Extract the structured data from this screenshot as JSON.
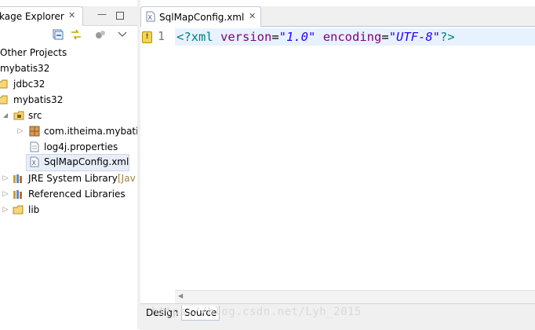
{
  "package_explorer": {
    "tab_label": "kage Explorer",
    "tree": [
      {
        "label": "Other Projects",
        "suffix": ""
      },
      {
        "label": "mybatis32",
        "suffix": ""
      },
      {
        "label": "jdbc32",
        "suffix": ""
      },
      {
        "label": "mybatis32",
        "suffix": ""
      },
      {
        "label": "src",
        "suffix": ""
      },
      {
        "label": "com.itheima.mybatis",
        "suffix": ""
      },
      {
        "label": "log4j.properties",
        "suffix": ""
      },
      {
        "label": "SqlMapConfig.xml",
        "suffix": ""
      },
      {
        "label": "JRE System Library",
        "suffix": "[Jav"
      },
      {
        "label": "Referenced Libraries",
        "suffix": ""
      },
      {
        "label": "lib",
        "suffix": ""
      }
    ]
  },
  "editor": {
    "tab_label": "SqlMapConfig.xml",
    "line_number": "1",
    "code_tokens": {
      "open": "<?xml ",
      "attr1": "version",
      "eq1": "=",
      "val1": "\"1.0\"",
      "sp": " ",
      "attr2": "encoding",
      "eq2": "=",
      "val2": "\"UTF-8\"",
      "close": "?>"
    },
    "bottom_tabs": [
      "Design",
      "Source"
    ]
  },
  "watermark": "https://blog.csdn.net/Lyh_2015",
  "colors": {
    "xml_tag": "#008080",
    "xml_attr": "#7f007f",
    "xml_string": "#2a00ff",
    "current_line": "#e8f2fe"
  },
  "icons": [
    "close-icon",
    "collapse-all-icon",
    "link-with-editor-icon",
    "view-menu-icon",
    "minimize-icon",
    "maximize-icon",
    "project-icon",
    "folder-icon",
    "package-icon",
    "file-icon",
    "xml-file-icon",
    "library-icon",
    "warning-icon"
  ]
}
